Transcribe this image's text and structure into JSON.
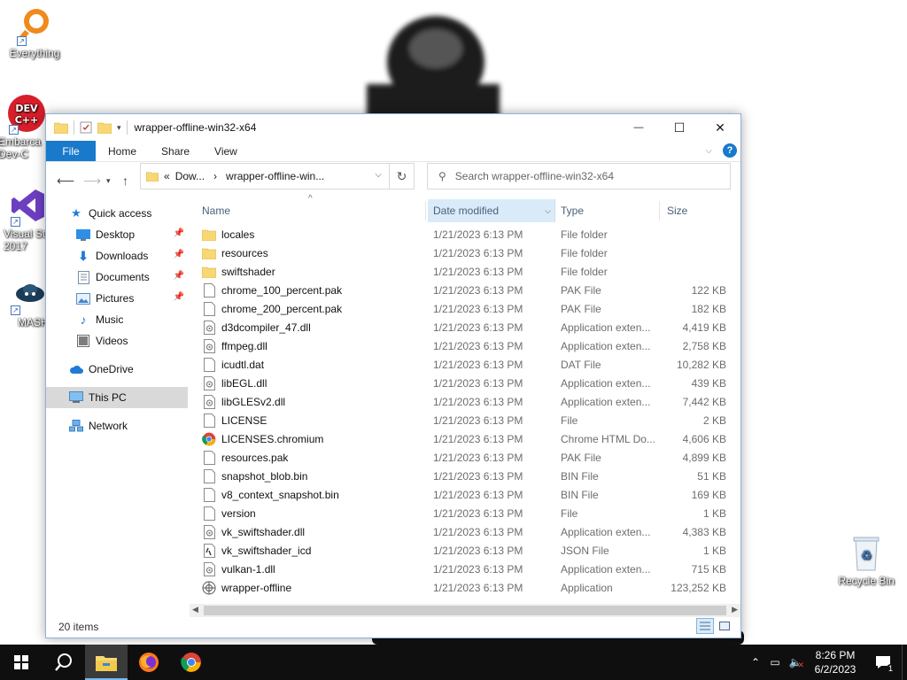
{
  "desktop": {
    "icons": [
      {
        "label": "Everything"
      },
      {
        "label": "Embarca Dev-C"
      },
      {
        "label": "Visual St 2017"
      },
      {
        "label": "MASH"
      },
      {
        "label": "Recycle Bin"
      }
    ]
  },
  "window": {
    "title": "wrapper-offline-win32-x64",
    "controls": {
      "minimize": "—",
      "maximize": "☐",
      "close": "✕"
    },
    "ribbon": {
      "file": "File",
      "home": "Home",
      "share": "Share",
      "view": "View",
      "help": "?"
    },
    "address": {
      "prefix": "«",
      "crumb1": "Dow...",
      "sep": "›",
      "crumb2": "wrapper-offline-win..."
    },
    "search": {
      "placeholder": "Search wrapper-offline-win32-x64"
    },
    "nav": {
      "quick_access": "Quick access",
      "desktop": "Desktop",
      "downloads": "Downloads",
      "documents": "Documents",
      "pictures": "Pictures",
      "music": "Music",
      "videos": "Videos",
      "onedrive": "OneDrive",
      "this_pc": "This PC",
      "network": "Network"
    },
    "columns": {
      "name": "Name",
      "date": "Date modified",
      "type": "Type",
      "size": "Size"
    },
    "files": [
      {
        "name": "locales",
        "date": "1/21/2023 6:13 PM",
        "type": "File folder",
        "size": "",
        "icon": "folder-icon"
      },
      {
        "name": "resources",
        "date": "1/21/2023 6:13 PM",
        "type": "File folder",
        "size": "",
        "icon": "folder-icon"
      },
      {
        "name": "swiftshader",
        "date": "1/21/2023 6:13 PM",
        "type": "File folder",
        "size": "",
        "icon": "folder-icon"
      },
      {
        "name": "chrome_100_percent.pak",
        "date": "1/21/2023 6:13 PM",
        "type": "PAK File",
        "size": "122 KB",
        "icon": "file-icon"
      },
      {
        "name": "chrome_200_percent.pak",
        "date": "1/21/2023 6:13 PM",
        "type": "PAK File",
        "size": "182 KB",
        "icon": "file-icon"
      },
      {
        "name": "d3dcompiler_47.dll",
        "date": "1/21/2023 6:13 PM",
        "type": "Application exten...",
        "size": "4,419 KB",
        "icon": "dll-icon"
      },
      {
        "name": "ffmpeg.dll",
        "date": "1/21/2023 6:13 PM",
        "type": "Application exten...",
        "size": "2,758 KB",
        "icon": "dll-icon"
      },
      {
        "name": "icudtl.dat",
        "date": "1/21/2023 6:13 PM",
        "type": "DAT File",
        "size": "10,282 KB",
        "icon": "file-icon"
      },
      {
        "name": "libEGL.dll",
        "date": "1/21/2023 6:13 PM",
        "type": "Application exten...",
        "size": "439 KB",
        "icon": "dll-icon"
      },
      {
        "name": "libGLESv2.dll",
        "date": "1/21/2023 6:13 PM",
        "type": "Application exten...",
        "size": "7,442 KB",
        "icon": "dll-icon"
      },
      {
        "name": "LICENSE",
        "date": "1/21/2023 6:13 PM",
        "type": "File",
        "size": "2 KB",
        "icon": "file-icon"
      },
      {
        "name": "LICENSES.chromium",
        "date": "1/21/2023 6:13 PM",
        "type": "Chrome HTML Do...",
        "size": "4,606 KB",
        "icon": "chrome-icon"
      },
      {
        "name": "resources.pak",
        "date": "1/21/2023 6:13 PM",
        "type": "PAK File",
        "size": "4,899 KB",
        "icon": "file-icon"
      },
      {
        "name": "snapshot_blob.bin",
        "date": "1/21/2023 6:13 PM",
        "type": "BIN File",
        "size": "51 KB",
        "icon": "file-icon"
      },
      {
        "name": "v8_context_snapshot.bin",
        "date": "1/21/2023 6:13 PM",
        "type": "BIN File",
        "size": "169 KB",
        "icon": "file-icon"
      },
      {
        "name": "version",
        "date": "1/21/2023 6:13 PM",
        "type": "File",
        "size": "1 KB",
        "icon": "file-icon"
      },
      {
        "name": "vk_swiftshader.dll",
        "date": "1/21/2023 6:13 PM",
        "type": "Application exten...",
        "size": "4,383 KB",
        "icon": "dll-icon"
      },
      {
        "name": "vk_swiftshader_icd",
        "date": "1/21/2023 6:13 PM",
        "type": "JSON File",
        "size": "1 KB",
        "icon": "json-icon"
      },
      {
        "name": "vulkan-1.dll",
        "date": "1/21/2023 6:13 PM",
        "type": "Application exten...",
        "size": "715 KB",
        "icon": "dll-icon"
      },
      {
        "name": "wrapper-offline",
        "date": "1/21/2023 6:13 PM",
        "type": "Application",
        "size": "123,252 KB",
        "icon": "app-icon"
      }
    ],
    "status": "20 items"
  },
  "taskbar": {
    "time": "8:26 PM",
    "date": "6/2/2023",
    "notification_count": "1"
  },
  "colors": {
    "accent": "#1979ca",
    "folder": "#f8d775"
  }
}
